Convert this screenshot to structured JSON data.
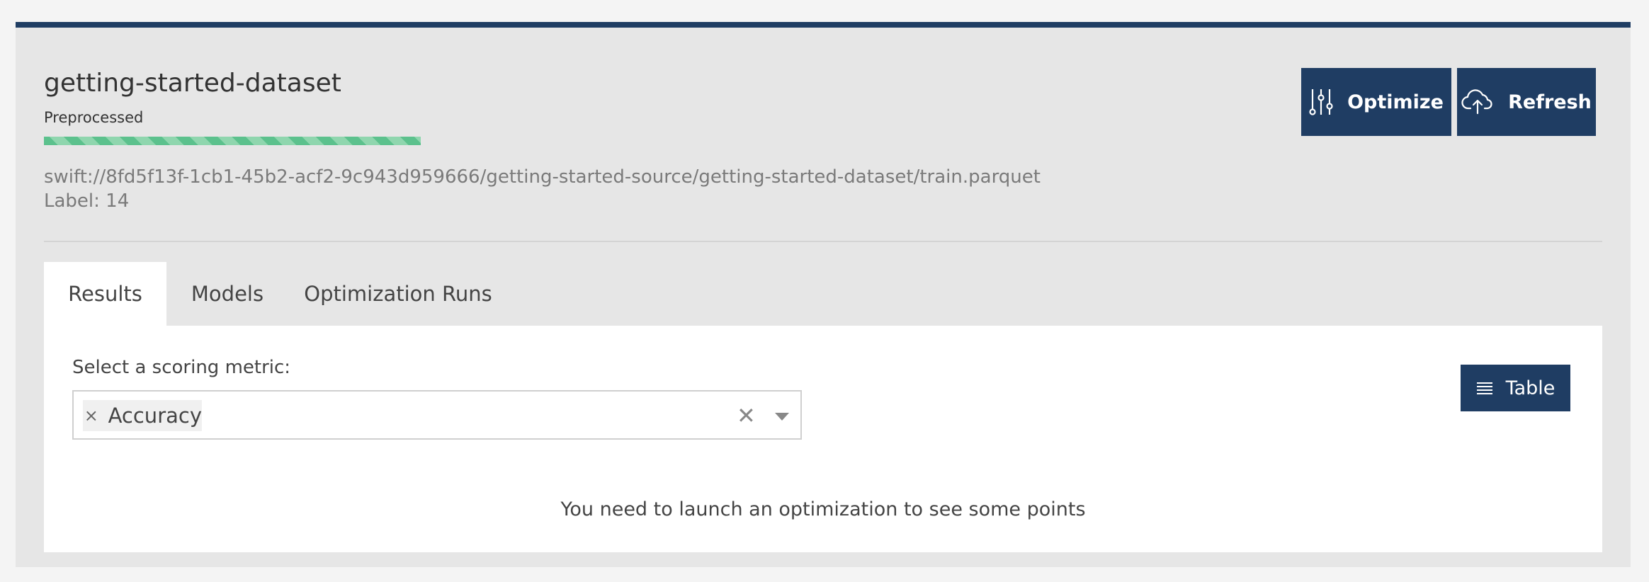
{
  "dataset": {
    "title": "getting-started-dataset",
    "status": "Preprocessed",
    "progress": 1.0,
    "path": "swift://8fd5f13f-1cb1-45b2-acf2-9c943d959666/getting-started-source/getting-started-dataset/train.parquet",
    "label": "Label: 14"
  },
  "toolbar": {
    "optimize_label": "Optimize",
    "optimize_icon": "sliders-icon",
    "refresh_label": "Refresh",
    "refresh_icon": "cloud-upload-icon"
  },
  "tabs": [
    {
      "label": "Results",
      "active": true
    },
    {
      "label": "Models",
      "active": false
    },
    {
      "label": "Optimization Runs",
      "active": false
    }
  ],
  "results": {
    "metric_label": "Select a scoring metric:",
    "selected_metric": "Accuracy",
    "chip_remove": "×",
    "clear_symbol": "✕",
    "table_button_label": "Table",
    "table_icon": "list-icon",
    "empty_message": "You need to launch an optimization to see some points"
  },
  "colors": {
    "accent": "#1f3d63",
    "progress": "#5cc18d"
  }
}
